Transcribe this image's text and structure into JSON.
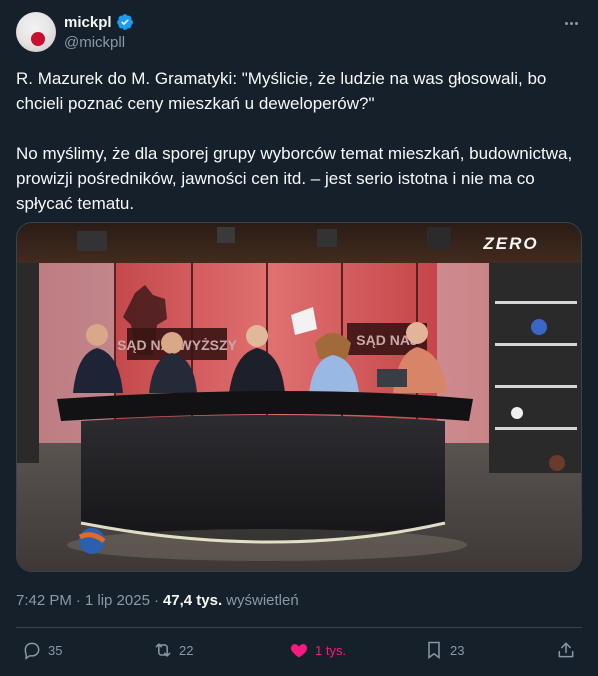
{
  "author": {
    "display_name": "mickpl",
    "handle": "@mickpll"
  },
  "tweet": {
    "text": "R. Mazurek do M. Gramatyki: \"Myślicie, że ludzie na was głosowali, bo chcieli poznać ceny mieszkań u deweloperów?\"\n\nNo myślimy, że dla sporej grupy wyborców temat mieszkań, budownictwa, prowizji pośredników, jawności cen itd. – jest serio istotna i nie ma co spłycać tematu."
  },
  "media": {
    "watermark": "ZERO",
    "sign_left": "SĄD NAJWYŻSZY",
    "sign_right": "SĄD NAJ",
    "accent_color": "#1d9bf0"
  },
  "meta": {
    "time": "7:42 PM",
    "date": "1 lip 2025",
    "sep": "·",
    "views_count": "47,4 tys.",
    "views_label": "wyświetleń"
  },
  "actions": {
    "replies": "35",
    "reposts": "22",
    "likes": "1 tys.",
    "bookmarks": "23"
  },
  "colors": {
    "background": "#15202b",
    "like": "#f91880",
    "verified": "#1d9bf0"
  }
}
